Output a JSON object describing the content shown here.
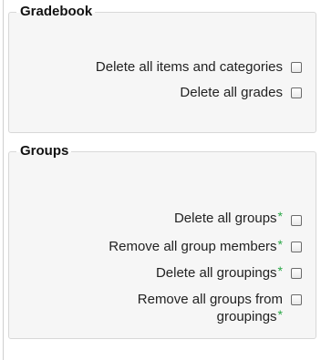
{
  "sections": {
    "gradebook": {
      "title": "Gradebook",
      "items": [
        {
          "label": "Delete all items and categories",
          "required": false
        },
        {
          "label": "Delete all grades",
          "required": false
        }
      ]
    },
    "groups": {
      "title": "Groups",
      "items": [
        {
          "label": "Delete all groups",
          "required": true
        },
        {
          "label": "Remove all group members",
          "required": true
        },
        {
          "label": "Delete all groupings",
          "required": true
        },
        {
          "label": "Remove all groups from groupings",
          "required": true
        }
      ]
    }
  },
  "required_marker": "*",
  "colors": {
    "required_marker": "#28a745",
    "fieldset_background": "#f6f6f6",
    "fieldset_border": "#d8d8d8"
  }
}
